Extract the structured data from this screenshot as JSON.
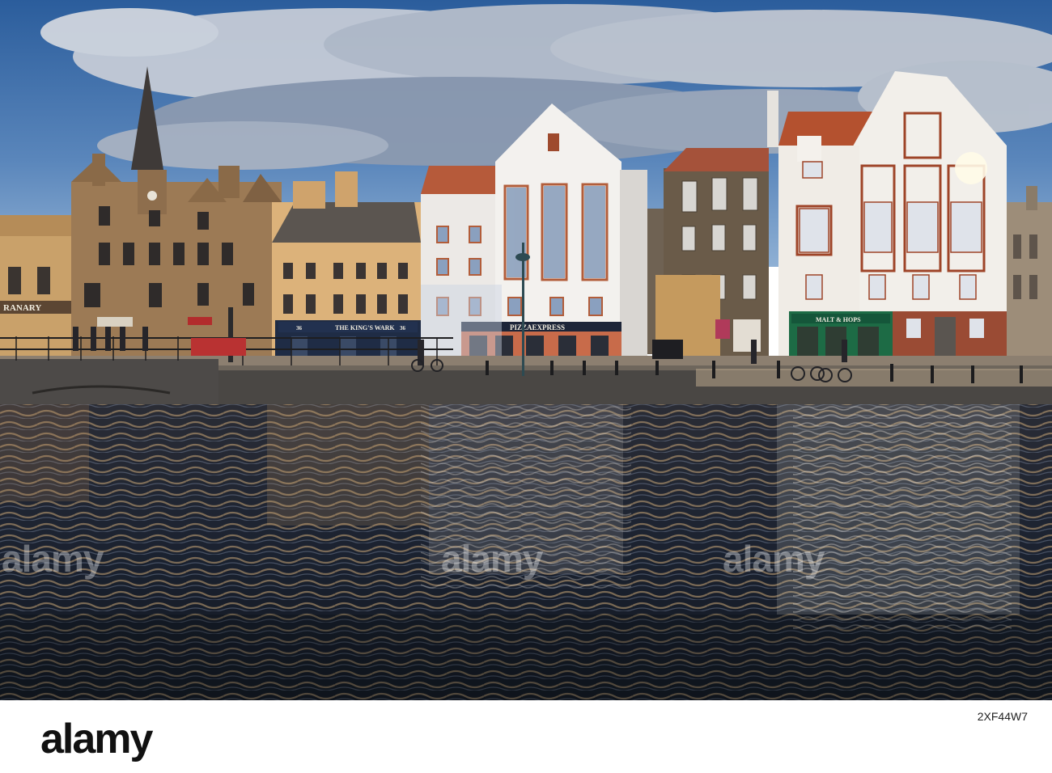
{
  "photo": {
    "signs": {
      "granary": "RANARY",
      "kings_wark": "THE KING'S WARK",
      "kings_wark_number_left": "36",
      "kings_wark_number_right": "36",
      "pizza_express": "PIZZAEXPRESS",
      "malt_hops": "MALT & HOPS"
    }
  },
  "watermarks": {
    "left": "alamy",
    "center": "alamy",
    "right": "alamy"
  },
  "footer": {
    "logo": "alamy",
    "image_id": "2XF44W7"
  }
}
